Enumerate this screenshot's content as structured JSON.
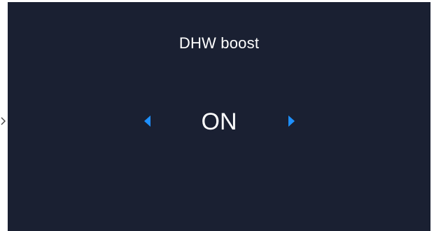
{
  "screen": {
    "title": "DHW boost",
    "value": "ON",
    "background_color": "#1a2032",
    "accent_color": "#1e90ff"
  },
  "controls": {
    "previous_icon": "caret-left-icon",
    "next_icon": "caret-right-icon",
    "edge_pointer_icon": "chevron-right-icon"
  }
}
